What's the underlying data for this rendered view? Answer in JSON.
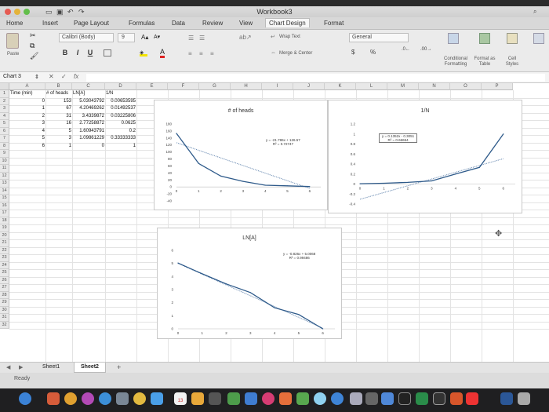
{
  "window": {
    "title": "Workbook3"
  },
  "ribbon_tabs": [
    {
      "label": "Home"
    },
    {
      "label": "Insert"
    },
    {
      "label": "Page Layout"
    },
    {
      "label": "Formulas"
    },
    {
      "label": "Data"
    },
    {
      "label": "Review"
    },
    {
      "label": "View"
    },
    {
      "label": "Chart Design"
    },
    {
      "label": "Format"
    }
  ],
  "ribbon": {
    "paste": "Paste",
    "font_name": "Calibri (Body)",
    "font_size": "9",
    "bold": "B",
    "italic": "I",
    "underline": "U",
    "wrap_text": "Wrap Text",
    "merge_center": "Merge & Center",
    "number_format": "General",
    "currency": "$",
    "percent": "%",
    "conditional_formatting": "Conditional Formatting",
    "format_as_table": "Format as Table",
    "cell_styles": "Cell Styles"
  },
  "formula_bar": {
    "name_box": "Chart 3",
    "fx": "fx"
  },
  "columns": [
    "A",
    "B",
    "C",
    "D",
    "E",
    "F",
    "G",
    "H",
    "I",
    "J",
    "K",
    "L",
    "M",
    "N",
    "O",
    "P"
  ],
  "rows": [
    "1",
    "2",
    "3",
    "4",
    "5",
    "6",
    "7",
    "8",
    "9",
    "10",
    "11",
    "12",
    "13",
    "14",
    "15",
    "16",
    "17",
    "18",
    "19",
    "20",
    "21",
    "22",
    "23",
    "24",
    "25",
    "26",
    "27",
    "28",
    "29",
    "30",
    "31",
    "32"
  ],
  "table": {
    "headers": [
      "Time (min)",
      "# of heads",
      "LN[A]",
      "1/N"
    ],
    "rows": [
      [
        "0",
        "153",
        "5.03043792",
        "0.00653595"
      ],
      [
        "1",
        "67",
        "4.20469262",
        "0.01492537"
      ],
      [
        "2",
        "31",
        "3.4339872",
        "0.03225806"
      ],
      [
        "3",
        "16",
        "2.77258872",
        "0.0625"
      ],
      [
        "4",
        "5",
        "1.60943791",
        "0.2"
      ],
      [
        "5",
        "3",
        "1.09861229",
        "0.33333333"
      ],
      [
        "6",
        "1",
        "0",
        "1"
      ]
    ]
  },
  "charts": {
    "heads": {
      "title": "# of heads",
      "equation": "y = -21.786x + 126.57",
      "r2": "R² = 0.72747",
      "y_ticks": [
        "180",
        "160",
        "140",
        "120",
        "100",
        "80",
        "60",
        "40",
        "20",
        "0",
        "-20",
        "-40"
      ],
      "x_ticks": [
        "0",
        "1",
        "2",
        "3",
        "4",
        "5",
        "6"
      ]
    },
    "inv": {
      "title": "1/N",
      "equation": "y = 0.1352x - 0.3051",
      "r2": "R² = 0.66654",
      "y_ticks": [
        "1.2",
        "1",
        "0.8",
        "0.6",
        "0.4",
        "0.2",
        "0",
        "-0.2",
        "-0.4"
      ],
      "x_ticks": [
        "0",
        "1",
        "2",
        "3",
        "4",
        "5",
        "6"
      ]
    },
    "ln": {
      "title": "LN[A]",
      "equation": "y = -0.826x + 5.0068",
      "r2": "R² = 0.99486",
      "y_ticks": [
        "6",
        "5",
        "4",
        "3",
        "2",
        "1",
        "0"
      ],
      "x_ticks": [
        "0",
        "1",
        "2",
        "3",
        "4",
        "5",
        "6"
      ]
    }
  },
  "chart_data": [
    {
      "type": "line",
      "title": "# of heads",
      "x": [
        0,
        1,
        2,
        3,
        4,
        5,
        6
      ],
      "series": [
        {
          "values": [
            153,
            67,
            31,
            16,
            5,
            3,
            1
          ]
        }
      ],
      "trendline": {
        "slope": -21.786,
        "intercept": 126.57
      },
      "ylim": [
        -40,
        180
      ]
    },
    {
      "type": "line",
      "title": "1/N",
      "x": [
        0,
        1,
        2,
        3,
        4,
        5,
        6
      ],
      "series": [
        {
          "values": [
            0.00653595,
            0.01492537,
            0.03225806,
            0.0625,
            0.2,
            0.33333333,
            1
          ]
        }
      ],
      "trendline": {
        "slope": 0.1352,
        "intercept": -0.3051
      },
      "ylim": [
        -0.4,
        1.2
      ]
    },
    {
      "type": "line",
      "title": "LN[A]",
      "x": [
        0,
        1,
        2,
        3,
        4,
        5,
        6
      ],
      "series": [
        {
          "values": [
            5.03043792,
            4.20469262,
            3.4339872,
            2.77258872,
            1.60943791,
            1.09861229,
            0
          ]
        }
      ],
      "trendline": {
        "slope": -0.826,
        "intercept": 5.0068
      },
      "ylim": [
        0,
        6
      ]
    }
  ],
  "sheets": [
    {
      "label": "Sheet1"
    },
    {
      "label": "Sheet2"
    }
  ],
  "add_sheet": "+",
  "status": "Ready",
  "dock_badge": "13",
  "colors": {
    "series": "#2e5a8a",
    "trend": "#6f8fb5",
    "accent": "#1e7145"
  }
}
